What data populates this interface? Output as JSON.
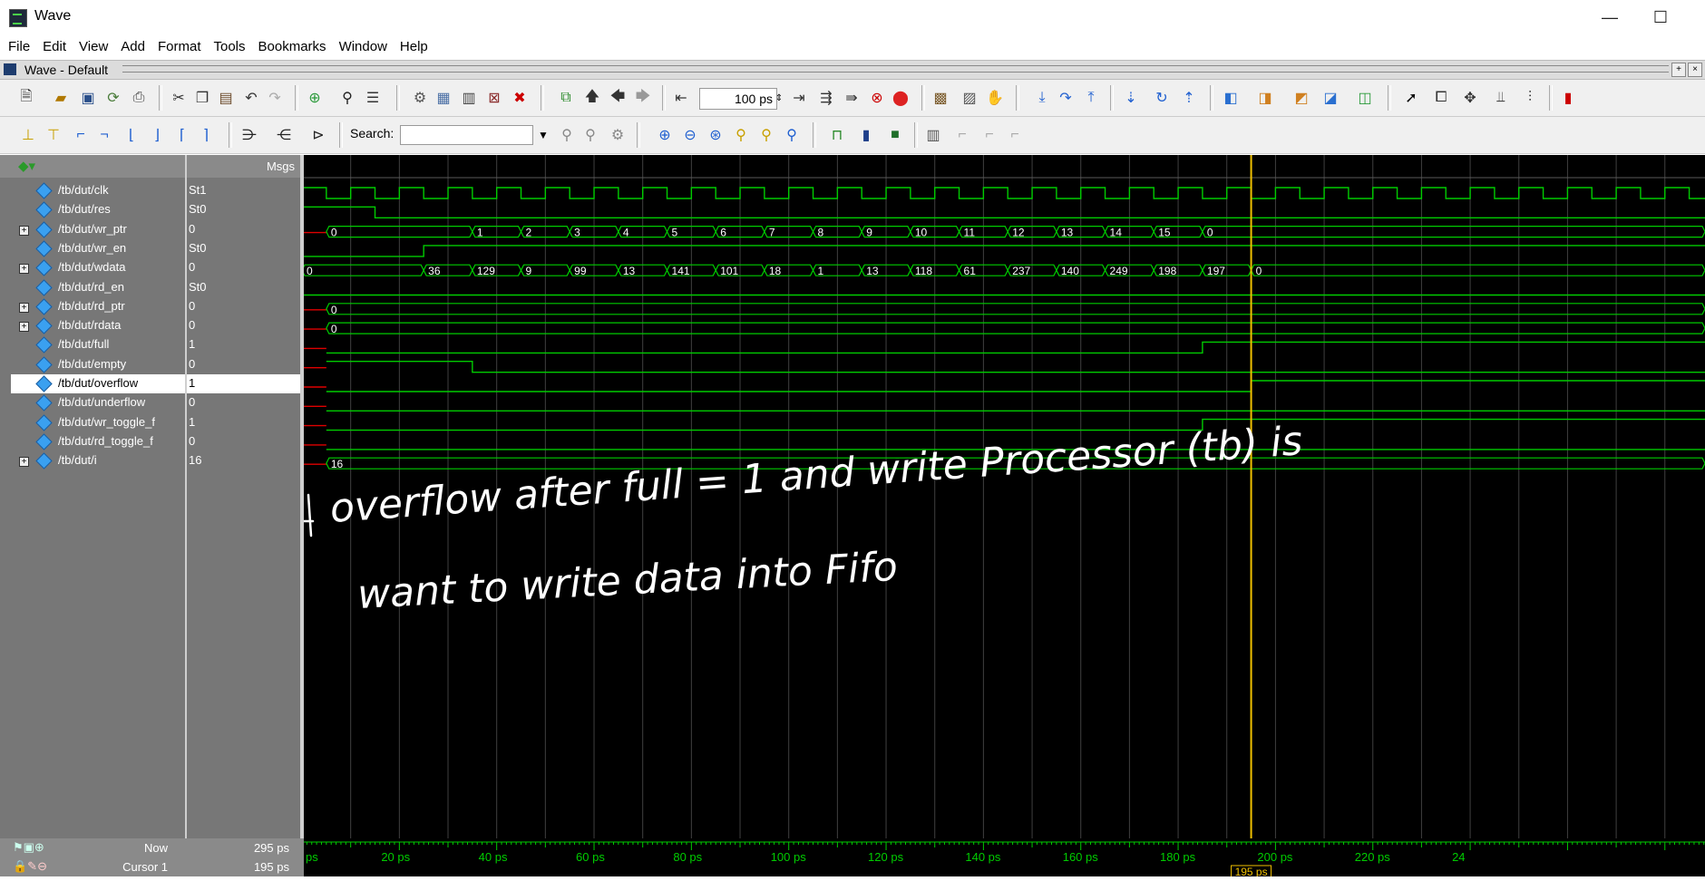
{
  "window": {
    "title": "Wave",
    "minimize": "—",
    "maximize": "☐"
  },
  "menu": [
    "File",
    "Edit",
    "View",
    "Add",
    "Format",
    "Tools",
    "Bookmarks",
    "Window",
    "Help"
  ],
  "pane": {
    "title": "Wave - Default"
  },
  "toolbar": {
    "time_step": "100",
    "time_unit": "ps",
    "search_label": "Search:",
    "search_value": ""
  },
  "headers": {
    "msgs": "Msgs"
  },
  "signals": [
    {
      "name": "/tb/dut/clk",
      "value": "St1",
      "expandable": false,
      "selected": false
    },
    {
      "name": "/tb/dut/res",
      "value": "St0",
      "expandable": false,
      "selected": false
    },
    {
      "name": "/tb/dut/wr_ptr",
      "value": "0",
      "expandable": true,
      "selected": false
    },
    {
      "name": "/tb/dut/wr_en",
      "value": "St0",
      "expandable": false,
      "selected": false
    },
    {
      "name": "/tb/dut/wdata",
      "value": "0",
      "expandable": true,
      "selected": false
    },
    {
      "name": "/tb/dut/rd_en",
      "value": "St0",
      "expandable": false,
      "selected": false
    },
    {
      "name": "/tb/dut/rd_ptr",
      "value": "0",
      "expandable": true,
      "selected": false
    },
    {
      "name": "/tb/dut/rdata",
      "value": "0",
      "expandable": true,
      "selected": false
    },
    {
      "name": "/tb/dut/full",
      "value": "1",
      "expandable": false,
      "selected": false
    },
    {
      "name": "/tb/dut/empty",
      "value": "0",
      "expandable": false,
      "selected": false
    },
    {
      "name": "/tb/dut/overflow",
      "value": "1",
      "expandable": false,
      "selected": true
    },
    {
      "name": "/tb/dut/underflow",
      "value": "0",
      "expandable": false,
      "selected": false
    },
    {
      "name": "/tb/dut/wr_toggle_f",
      "value": "1",
      "expandable": false,
      "selected": false
    },
    {
      "name": "/tb/dut/rd_toggle_f",
      "value": "0",
      "expandable": false,
      "selected": false
    },
    {
      "name": "/tb/dut/i",
      "value": "16",
      "expandable": true,
      "selected": false
    }
  ],
  "buses": {
    "wr_ptr": [
      "0",
      "1",
      "2",
      "3",
      "4",
      "5",
      "6",
      "7",
      "8",
      "9",
      "10",
      "11",
      "12",
      "13",
      "14",
      "15",
      "0"
    ],
    "wdata": [
      "0",
      "36",
      "129",
      "9",
      "99",
      "13",
      "141",
      "101",
      "18",
      "1",
      "13",
      "118",
      "61",
      "237",
      "140",
      "249",
      "198",
      "197",
      "0"
    ],
    "rd_ptr": [
      "0"
    ],
    "rdata": [
      "0"
    ],
    "i": [
      "16"
    ]
  },
  "footer": {
    "now_label": "Now",
    "now_value": "295 ps",
    "cursor_label": "Cursor 1",
    "cursor_value": "195 ps"
  },
  "timeline": {
    "labels": [
      "ps",
      "20 ps",
      "40 ps",
      "60 ps",
      "80 ps",
      "100 ps",
      "120 ps",
      "140 ps",
      "160 ps",
      "180 ps",
      "200 ps",
      "220 ps",
      "24"
    ],
    "cursor_label": "195 ps"
  },
  "annotation": {
    "line1": "overflow after full = 1 and write Processor (tb) is",
    "line2": "want to write data into Fifo"
  },
  "colors": {
    "wave": "#00cc00",
    "cursor": "#f0c000",
    "grid": "#404040",
    "x_value": "#e00000",
    "annotation": "#ffffff"
  }
}
